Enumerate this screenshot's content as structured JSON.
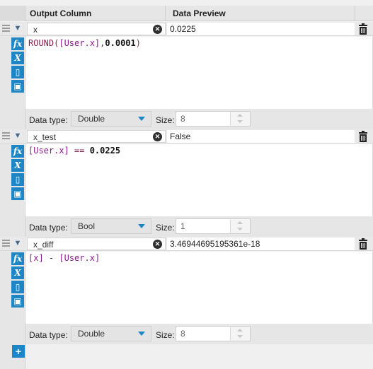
{
  "header": {
    "output_column": "Output Column",
    "data_preview": "Data Preview"
  },
  "rows": [
    {
      "name": "x",
      "preview": "0.0225",
      "expression": {
        "func": "ROUND(",
        "field": "[User.x]",
        "sep": ",",
        "num": "0.0001",
        "close": ")"
      },
      "data_type_label": "Data type:",
      "data_type": "Double",
      "size_label": "Size:",
      "size": "8"
    },
    {
      "name": "x_test",
      "preview": "False",
      "expression": {
        "field": "[User.x]",
        "op": " == ",
        "num": "0.0225"
      },
      "data_type_label": "Data type:",
      "data_type": "Bool",
      "size_label": "Size:",
      "size": "1"
    },
    {
      "name": "x_diff",
      "preview": "3.46944695195361e-18",
      "expression": {
        "left": "[x]",
        "op": " - ",
        "field": "[User.x]"
      },
      "data_type_label": "Data type:",
      "data_type": "Double",
      "size_label": "Size:",
      "size": "8"
    }
  ],
  "icons": {
    "fx": "fx-icon",
    "variable": "variable-x-icon",
    "open": "folder-open-icon",
    "save": "save-icon",
    "delete": "trash-icon",
    "add": "plus-icon",
    "clear": "clear-icon",
    "collapse": "chevron-down-icon",
    "drag": "drag-handle-icon"
  },
  "colors": {
    "accent": "#1f86c5",
    "function": "#8b2252",
    "field": "#8b1a8b"
  }
}
